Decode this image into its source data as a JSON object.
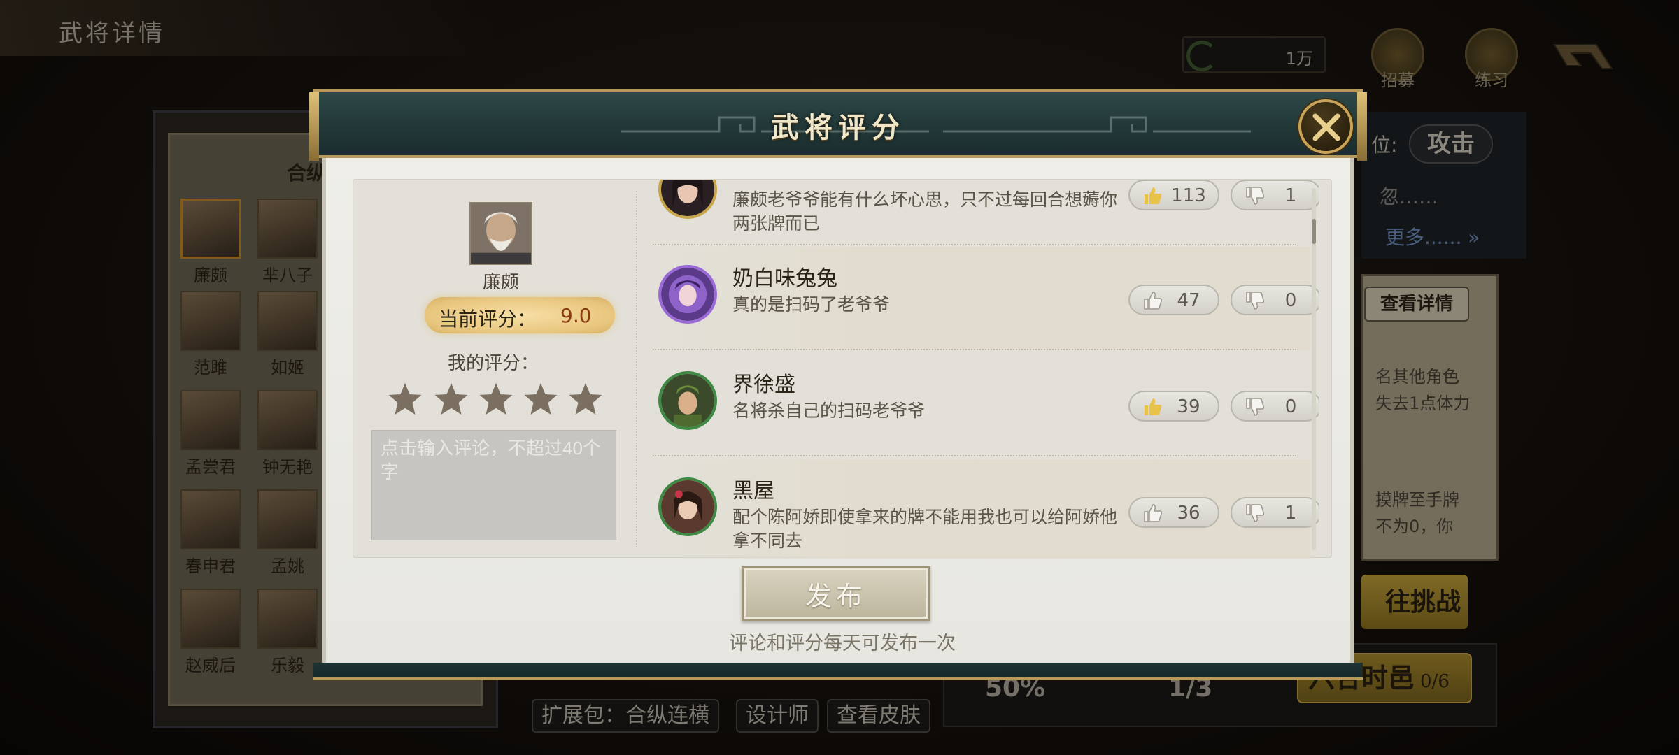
{
  "page": {
    "title": "武将详情"
  },
  "currency": {
    "value": "1万"
  },
  "top_buttons": [
    {
      "label": "招募",
      "icon": "recruit-icon"
    },
    {
      "label": "练习",
      "icon": "practice-icon"
    }
  ],
  "roster": {
    "label": "合纵",
    "heroes": [
      {
        "name": "廉颇",
        "selected": true
      },
      {
        "name": "芈八子"
      },
      {
        "name": "范雎"
      },
      {
        "name": "如姬"
      },
      {
        "name": "孟尝君"
      },
      {
        "name": "钟无艳"
      },
      {
        "name": "春申君"
      },
      {
        "name": "孟姚"
      },
      {
        "name": "赵威后"
      },
      {
        "name": "乐毅"
      }
    ]
  },
  "right_panel": {
    "position_label": "位:",
    "attack_button": "攻击",
    "snippet": "忽……",
    "more_link": "更多......",
    "detail_button": "查看详情",
    "desc_lines": [
      "名其他角色",
      "失去1点体力",
      "摸牌至手牌",
      "不为0，你"
    ],
    "challenge_button": "往挑战",
    "stat_percent": "50%",
    "stat_progress": "1/3",
    "hezong_button": "六合时邑",
    "hezong_count": "0/6"
  },
  "bottom_tags": [
    "扩展包：合纵连横",
    "设计师",
    "查看皮肤"
  ],
  "modal": {
    "title": "武将评分",
    "hero_name": "廉颇",
    "current_rating_label": "当前评分：",
    "current_rating_value": "9.0",
    "my_rating_label": "我的评分：",
    "my_rating_stars": 0,
    "comment_placeholder": "点击输入评论，不超过40个字",
    "publish_button": "发布",
    "publish_hint": "评论和评分每天可发布一次",
    "comments": [
      {
        "user": "",
        "text": "廉颇老爷爷能有什么坏心思，只不过每回合想薅你两张牌而已",
        "likes": "113",
        "dislikes": "1",
        "liked": true
      },
      {
        "user": "奶白味兔兔",
        "text": "真的是扫码了老爷爷",
        "likes": "47",
        "dislikes": "0",
        "liked": false
      },
      {
        "user": "界徐盛",
        "text": "名将杀自己的扫码老爷爷",
        "likes": "39",
        "dislikes": "0",
        "liked": true
      },
      {
        "user": "黑屋",
        "text": "配个陈阿娇即使拿来的牌不能用我也可以给阿娇他拿不同去",
        "likes": "36",
        "dislikes": "1",
        "liked": false
      }
    ]
  }
}
